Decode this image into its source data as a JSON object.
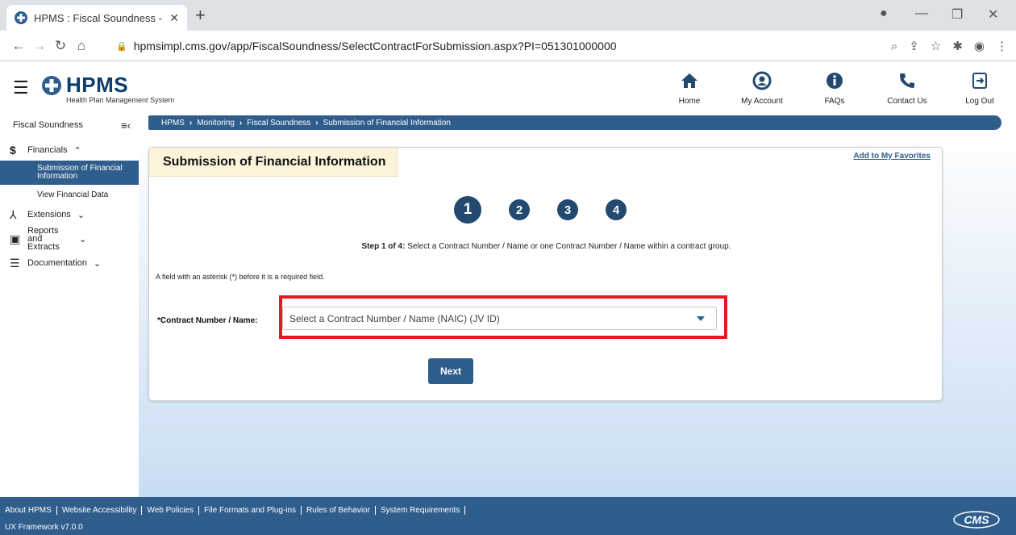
{
  "browser": {
    "tab_title": "HPMS : Fiscal Soundness - Subm",
    "url": "hpmsimpl.cms.gov/app/FiscalSoundness/SelectContractForSubmission.aspx?PI=051301000000"
  },
  "header": {
    "logo_text": "HPMS",
    "logo_subtitle": "Health Plan Management System",
    "nav": [
      {
        "label": "Home",
        "icon": "home-icon"
      },
      {
        "label": "My Account",
        "icon": "account-icon"
      },
      {
        "label": "FAQs",
        "icon": "info-icon"
      },
      {
        "label": "Contact Us",
        "icon": "phone-icon"
      },
      {
        "label": "Log Out",
        "icon": "logout-icon"
      }
    ]
  },
  "sidebar": {
    "title": "Fiscal Soundness",
    "sections": [
      {
        "label": "Financials",
        "icon": "dollar-icon",
        "expanded": true
      },
      {
        "label": "Extensions",
        "icon": "extensions-icon"
      },
      {
        "label": "Reports and Extracts",
        "icon": "clipboard-icon"
      },
      {
        "label": "Documentation",
        "icon": "list-icon"
      }
    ],
    "sub_items": [
      {
        "label": "Submission of Financial Information",
        "active": true
      },
      {
        "label": "View Financial Data"
      }
    ]
  },
  "breadcrumb": [
    "HPMS",
    "Monitoring",
    "Fiscal Soundness",
    "Submission of Financial Information"
  ],
  "panel": {
    "title": "Submission of Financial Information",
    "favorites_link": "Add to My Favorites",
    "steps": [
      "1",
      "2",
      "3",
      "4"
    ],
    "current_step": 1,
    "step_prefix": "Step 1 of 4:",
    "step_text": " Select a Contract Number / Name or one Contract Number / Name within a contract group.",
    "required_note": "A field with an asterisk (*) before it is a required field.",
    "field_label": "*Contract Number / Name:",
    "select_placeholder": "Select a Contract Number / Name (NAIC) (JV ID)",
    "next_label": "Next"
  },
  "footer": {
    "links": [
      "About HPMS",
      "Website Accessibility",
      "Web Policies",
      "File Formats and Plug-ins",
      "Rules of Behavior",
      "System Requirements"
    ],
    "version": "UX Framework v7.0.0",
    "logo_text": "CMS"
  },
  "colors": {
    "primary": "#2f5d8c",
    "highlight": "#e21b23",
    "panel_title_bg": "#fdf2da",
    "step_circle": "#23496f"
  }
}
